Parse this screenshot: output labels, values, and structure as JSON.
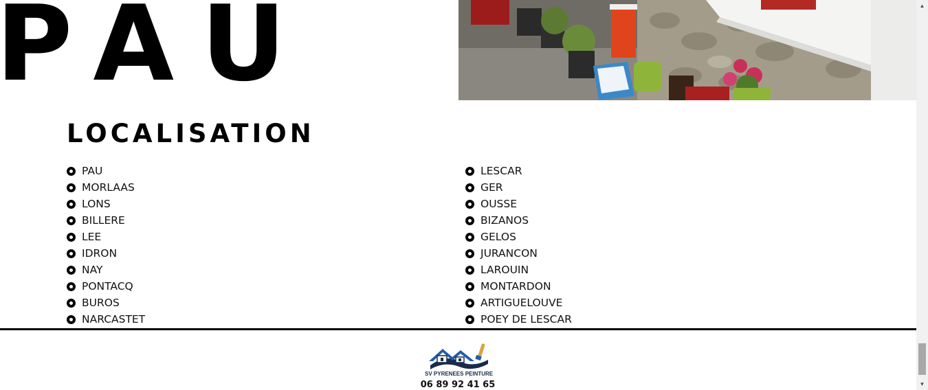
{
  "hero": {
    "title": "PAU"
  },
  "section": {
    "title": "LOCALISATION"
  },
  "locations": {
    "column1": [
      "PAU",
      "MORLAAS",
      "LONS",
      "BILLERE",
      "LEE",
      "IDRON",
      "NAY",
      "PONTACQ",
      "BUROS",
      "NARCASTET"
    ],
    "column2": [
      "LESCAR",
      "GER",
      "OUSSE",
      "BIZANOS",
      "GELOS",
      "JURANCON",
      "LAROUIN",
      "MONTARDON",
      "ARTIGUELOUVE",
      "POEY DE LESCAR"
    ]
  },
  "footer": {
    "logo_text": "SV PYRENEES PEINTURE",
    "phone": "06 89 92 41 65"
  },
  "colors": {
    "text": "#000000",
    "logo_blue": "#1f5fa8",
    "logo_navy": "#1a2b4a"
  }
}
